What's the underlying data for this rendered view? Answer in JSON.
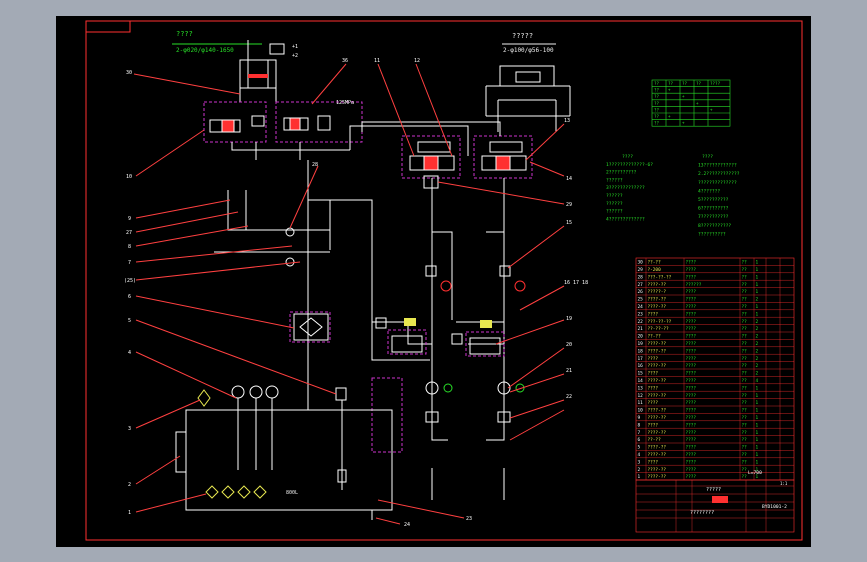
{
  "drawing": {
    "left_title": "????",
    "left_spec": "2-φ020/φ140-1650",
    "right_title": "?????",
    "right_spec": "2-φ100/φ56-100",
    "tank_label": "800L",
    "pressure_note": "125MPa",
    "load_label": "L=700",
    "callouts_left": [
      "30",
      "10",
      "9",
      "27",
      "8",
      "7",
      "(25)",
      "6",
      "5",
      "4",
      "3",
      "2",
      "1"
    ],
    "callouts_top": [
      "36",
      "11",
      "12",
      "13",
      "14",
      "28",
      "29",
      "15",
      "16 17 18",
      "19",
      "20",
      "21",
      "22",
      "23",
      "24"
    ],
    "notes_left": [
      "????",
      "1?????????????-6?",
      "2??????????",
      "??????",
      "3?????????????",
      "??????",
      "??????",
      "??????",
      "4?????????????"
    ],
    "notes_right": [
      "????",
      "13????????????",
      "2.2????????????",
      "??????????????",
      "4???????",
      "5??????????",
      "6??????????",
      "7??????????",
      "8???????????",
      "??????????"
    ]
  },
  "colors": {
    "frame": "#000000",
    "line": "#ffffff",
    "accent": "#ff3030",
    "dimension": "#28e028",
    "subassembly": "#cc33cc",
    "callout": "#ff4040",
    "table_border": "#ff3030",
    "table_text": "#28e028",
    "table_text_yellow": "#e8e850"
  },
  "bom": {
    "rows": [
      [
        "30",
        "??-??",
        "????",
        "??",
        "1",
        ""
      ],
      [
        "29",
        "?-200",
        "????",
        "??",
        "1",
        ""
      ],
      [
        "28",
        "???-??-??",
        "????",
        "??",
        "1",
        ""
      ],
      [
        "27",
        "????-??",
        "??????",
        "??",
        "1",
        ""
      ],
      [
        "26",
        "?????-?",
        "????",
        "??",
        "1",
        ""
      ],
      [
        "25",
        "????-??",
        "????",
        "??",
        "2",
        ""
      ],
      [
        "24",
        "????-??",
        "????",
        "??",
        "1",
        ""
      ],
      [
        "23",
        "????",
        "????",
        "??",
        "1",
        ""
      ],
      [
        "22",
        "???-??-??",
        "????",
        "??",
        "2",
        ""
      ],
      [
        "21",
        "??-??-??",
        "????",
        "??",
        "2",
        ""
      ],
      [
        "20",
        "??-??",
        "????",
        "??",
        "2",
        ""
      ],
      [
        "19",
        "????-??",
        "????",
        "??",
        "2",
        ""
      ],
      [
        "18",
        "????-??",
        "????",
        "??",
        "2",
        ""
      ],
      [
        "17",
        "????",
        "????",
        "??",
        "2",
        ""
      ],
      [
        "16",
        "????-??",
        "????",
        "??",
        "2",
        ""
      ],
      [
        "15",
        "????",
        "????",
        "??",
        "2",
        ""
      ],
      [
        "14",
        "????-??",
        "????",
        "??",
        "4",
        ""
      ],
      [
        "13",
        "????",
        "????",
        "??",
        "1",
        ""
      ],
      [
        "12",
        "????-??",
        "????",
        "??",
        "1",
        ""
      ],
      [
        "11",
        "????",
        "????",
        "??",
        "1",
        ""
      ],
      [
        "10",
        "????-??",
        "????",
        "??",
        "1",
        ""
      ],
      [
        "9",
        "????-??",
        "????",
        "??",
        "1",
        ""
      ],
      [
        "8",
        "????",
        "????",
        "??",
        "1",
        ""
      ],
      [
        "7",
        "????-??",
        "????",
        "??",
        "1",
        ""
      ],
      [
        "6",
        "??-??",
        "????",
        "??",
        "1",
        ""
      ],
      [
        "5",
        "????-??",
        "????",
        "??",
        "1",
        ""
      ],
      [
        "4",
        "????-??",
        "????",
        "??",
        "1",
        ""
      ],
      [
        "3",
        "????",
        "????",
        "??",
        "1",
        ""
      ],
      [
        "2",
        "????-??",
        "????",
        "??",
        "1",
        ""
      ],
      [
        "1",
        "????-??",
        "????",
        "??",
        "1",
        ""
      ]
    ],
    "title_main": "?????",
    "title_code": "BYD1001-2",
    "title_footer": "????????",
    "cell_scale": "1:1"
  },
  "top_table": {
    "rows": [
      [
        "??",
        "??",
        "??",
        "??",
        "????"
      ],
      [
        "??",
        "+",
        "",
        "",
        ""
      ],
      [
        "??",
        "",
        "+",
        "",
        ""
      ],
      [
        "??",
        "",
        "",
        "+",
        ""
      ],
      [
        "??",
        "",
        "",
        "",
        "+"
      ],
      [
        "??",
        "+",
        "",
        "",
        ""
      ],
      [
        "??",
        "",
        "+",
        "",
        ""
      ]
    ]
  }
}
